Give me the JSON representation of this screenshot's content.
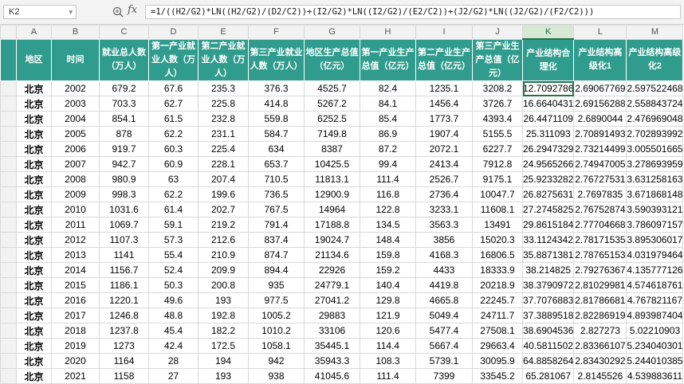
{
  "formula_bar": {
    "cell_ref": "K2",
    "formula": "=1/((H2/G2)*LN((H2/G2)/(D2/C2))+(I2/G2)*LN((I2/G2)/(E2/C2))+(J2/G2)*LN((J2/G2)/(F2/C2)))"
  },
  "columns": [
    "A",
    "B",
    "C",
    "D",
    "E",
    "F",
    "G",
    "H",
    "I",
    "J",
    "K",
    "L",
    "M"
  ],
  "headers": [
    "地区",
    "时间",
    "就业总人数（万人）",
    "第一产业就业人数（万人）",
    "第二产业就业人数（万人）",
    "第三产业就业人数（万人）",
    "地区生产总值（亿元）",
    "第一产业生产总值（亿元）",
    "第二产业生产总值（亿元）",
    "第三产业生产总值（亿元）",
    "产业结构合理化",
    "产业结构高级化1",
    "产业结构高级化2"
  ],
  "rows": [
    [
      "北京",
      "2002",
      "679.2",
      "67.6",
      "235.3",
      "376.3",
      "4525.7",
      "82.4",
      "1235.1",
      "3208.2",
      "12.7092786",
      "2.69067769",
      "2.597522468"
    ],
    [
      "北京",
      "2003",
      "703.3",
      "62.7",
      "225.8",
      "414.8",
      "5267.2",
      "84.1",
      "1456.4",
      "3726.7",
      "16.6640431",
      "2.69156288",
      "2.558843724"
    ],
    [
      "北京",
      "2004",
      "854.1",
      "61.5",
      "232.8",
      "559.8",
      "6252.5",
      "85.4",
      "1773.7",
      "4393.4",
      "26.4471109",
      "2.6890044",
      "2.476969048"
    ],
    [
      "北京",
      "2005",
      "878",
      "62.2",
      "231.1",
      "584.7",
      "7149.8",
      "86.9",
      "1907.4",
      "5155.5",
      "25.311093",
      "2.70891493",
      "2.702893992"
    ],
    [
      "北京",
      "2006",
      "919.7",
      "60.3",
      "225.4",
      "634",
      "8387",
      "87.2",
      "2072.1",
      "6227.7",
      "26.2947329",
      "2.73214499",
      "3.005501665"
    ],
    [
      "北京",
      "2007",
      "942.7",
      "60.9",
      "228.1",
      "653.7",
      "10425.5",
      "99.4",
      "2413.4",
      "7912.8",
      "24.9565266",
      "2.74947005",
      "3.278693959"
    ],
    [
      "北京",
      "2008",
      "980.9",
      "63",
      "207.4",
      "710.5",
      "11813.1",
      "111.4",
      "2526.7",
      "9175.1",
      "25.9233282",
      "2.76727531",
      "3.631258163"
    ],
    [
      "北京",
      "2009",
      "998.3",
      "62.2",
      "199.6",
      "736.5",
      "12900.9",
      "116.8",
      "2736.4",
      "10047.7",
      "26.8275631",
      "2.7697835",
      "3.671868148"
    ],
    [
      "北京",
      "2010",
      "1031.6",
      "61.4",
      "202.7",
      "767.5",
      "14964",
      "122.8",
      "3233.1",
      "11608.1",
      "27.2745825",
      "2.76752874",
      "3.590393121"
    ],
    [
      "北京",
      "2011",
      "1069.7",
      "59.1",
      "219.2",
      "791.4",
      "17188.8",
      "134.5",
      "3563.3",
      "13491",
      "29.8615184",
      "2.77704668",
      "3.786097157"
    ],
    [
      "北京",
      "2012",
      "1107.3",
      "57.3",
      "212.6",
      "837.4",
      "19024.7",
      "148.4",
      "3856",
      "15020.3",
      "33.1124342",
      "2.78171535",
      "3.895306017"
    ],
    [
      "北京",
      "2013",
      "1141",
      "55.4",
      "210.9",
      "874.7",
      "21134.6",
      "159.8",
      "4168.3",
      "16806.5",
      "35.8871381",
      "2.78765153",
      "4.031979464"
    ],
    [
      "北京",
      "2014",
      "1156.7",
      "52.4",
      "209.9",
      "894.4",
      "22926",
      "159.2",
      "4433",
      "18333.9",
      "38.214825",
      "2.79276367",
      "4.135777126"
    ],
    [
      "北京",
      "2015",
      "1186.1",
      "50.3",
      "200.8",
      "935",
      "24779.1",
      "140.4",
      "4419.8",
      "20218.9",
      "38.3790972",
      "2.81029981",
      "4.574618761"
    ],
    [
      "北京",
      "2016",
      "1220.1",
      "49.6",
      "193",
      "977.5",
      "27041.2",
      "129.8",
      "4665.8",
      "22245.7",
      "37.7076883",
      "2.81786681",
      "4.767821167"
    ],
    [
      "北京",
      "2017",
      "1246.8",
      "48.8",
      "192.8",
      "1005.2",
      "29883",
      "121.9",
      "5049.4",
      "24711.7",
      "37.3889518",
      "2.82286919",
      "4.893987404"
    ],
    [
      "北京",
      "2018",
      "1237.8",
      "45.4",
      "182.2",
      "1010.2",
      "33106",
      "120.6",
      "5477.4",
      "27508.1",
      "38.6904536",
      "2.827273",
      "5.02210903"
    ],
    [
      "北京",
      "2019",
      "1273",
      "42.4",
      "172.5",
      "1058.1",
      "35445.1",
      "114.4",
      "5667.4",
      "29663.4",
      "40.5811502",
      "2.83366107",
      "5.234040301"
    ],
    [
      "北京",
      "2020",
      "1164",
      "28",
      "194",
      "942",
      "35943.3",
      "108.3",
      "5739.1",
      "30095.9",
      "64.8858264",
      "2.83430292",
      "5.244010385"
    ],
    [
      "北京",
      "2021",
      "1158",
      "27",
      "193",
      "938",
      "41045.6",
      "111.4",
      "7399",
      "33545.2",
      "65.281067",
      "2.8145526",
      "4.539883611"
    ]
  ]
}
